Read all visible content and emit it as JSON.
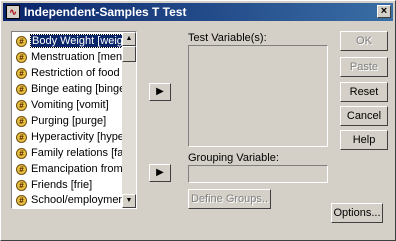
{
  "window": {
    "title": "Independent-Samples T Test",
    "close_label": "×"
  },
  "variables": [
    "Body Weight [weig",
    "Menstruation [mens",
    "Restriction of food i",
    "Binge eating [binge",
    "Vomiting [vomit]",
    "Purging [purge]",
    "Hyperactivity [hype",
    "Family relations [fan",
    "Emancipation from",
    "Friends [frie]",
    "School/employmen"
  ],
  "labels": {
    "test_variables": "Test Variable(s):",
    "grouping_variable": "Grouping Variable:"
  },
  "buttons": {
    "ok": "OK",
    "paste": "Paste",
    "reset": "Reset",
    "cancel": "Cancel",
    "help": "Help",
    "define_groups": "Define Groups..",
    "options": "Options..."
  },
  "icons": {
    "arrow": "▶",
    "scroll_up": "▲",
    "scroll_down": "▼",
    "variable": "#"
  }
}
